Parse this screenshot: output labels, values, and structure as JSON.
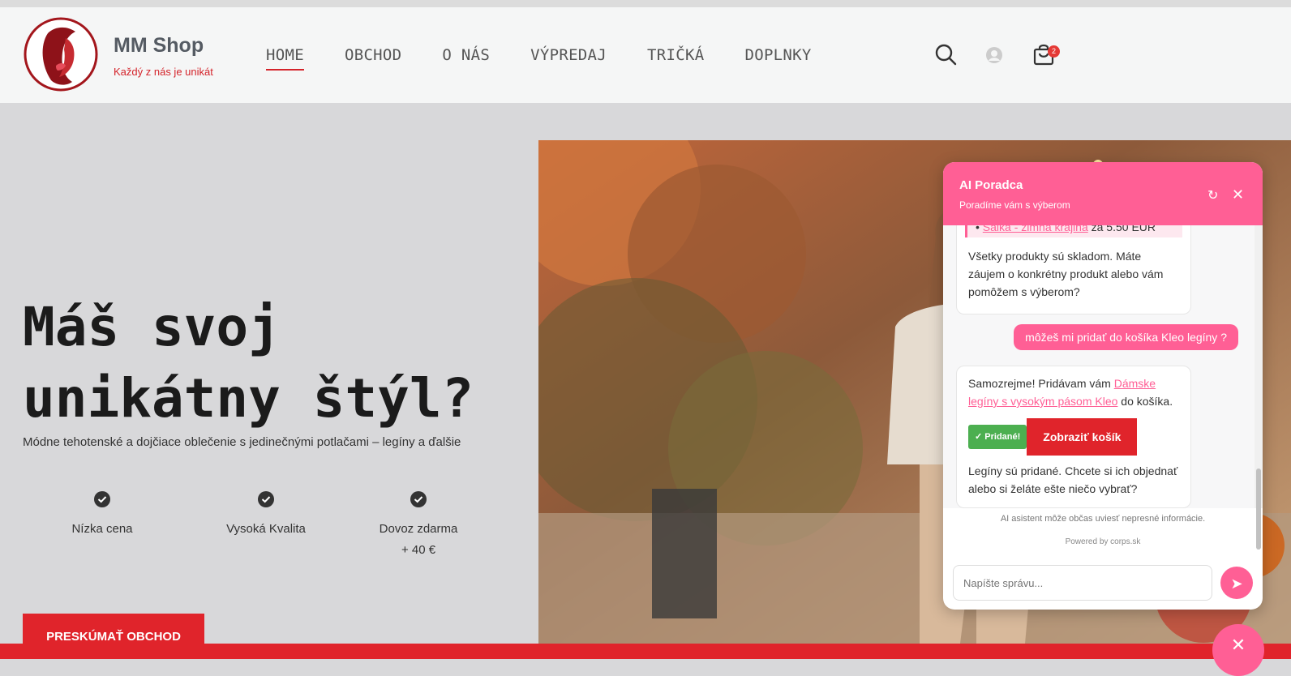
{
  "brand": {
    "name": "MM Shop",
    "tagline": "Každý z nás je unikát"
  },
  "nav": [
    {
      "label": "HOME",
      "active": true
    },
    {
      "label": "OBCHOD"
    },
    {
      "label": "O NÁS"
    },
    {
      "label": "VÝPREDAJ"
    },
    {
      "label": "TRIČKÁ"
    },
    {
      "label": "DOPLNKY"
    }
  ],
  "header_icons": {
    "search": "search-icon",
    "account": "user-icon",
    "cart": "bag-icon",
    "cart_count": "2"
  },
  "hero": {
    "title_line1": "Máš svoj",
    "title_line2": "unikátny štýl?",
    "subtitle": "Módne tehotenské a dojčiace oblečenie s jedinečnými potlačami – legíny a ďalšie",
    "features": [
      {
        "label": "Nízka cena"
      },
      {
        "label": "Vysoká Kvalita"
      },
      {
        "label": "Dovoz zdarma",
        "label2": "+ 40 €"
      }
    ],
    "cta": "PRESKÚMAŤ OBCHOD"
  },
  "chat": {
    "title": "AI Poradca",
    "subtitle": "Poradíme vám s výberom",
    "messages": {
      "bot1_item_link": "Šálka - zimná krajina",
      "bot1_item_price": "za 5.50 EUR",
      "bot1_text": "Všetky produkty sú skladom. Máte záujem o konkrétny produkt alebo vám pomôžem s výberom?",
      "user1": "môžeš mi pridať do košíka Kleo legíny ?",
      "bot2_pre": "Samozrejme! Pridávam vám",
      "bot2_link": "Dámske legíny s vysokým pásom Kleo",
      "bot2_post": "do košíka.",
      "added_badge": "✓ Pridané!",
      "view_cart": "Zobraziť košík",
      "bot2_after": "Legíny sú pridané. Chcete si ich objednať alebo si želáte ešte niečo vybrať?"
    },
    "disclaimer": "AI asistent môže občas uviesť nepresné informácie.",
    "powered": "Powered by corps.sk",
    "input_placeholder": "Napíšte správu..."
  },
  "colors": {
    "accent_red": "#e0242b",
    "chat_pink": "#ff5f95"
  }
}
